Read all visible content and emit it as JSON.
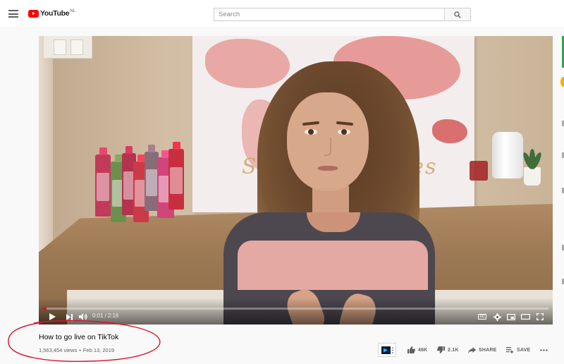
{
  "header": {
    "logo_text": "YouTube",
    "logo_region": "NL",
    "search_placeholder": "Search"
  },
  "player": {
    "current_time": "0:01",
    "separator": "/",
    "duration": "2:16",
    "progress_fraction": 0.0074,
    "cc_label": "CC",
    "map_script_left": "S",
    "map_script_right": "laces"
  },
  "video": {
    "title": "How to go live on TikTok",
    "views": "1,563,454 views",
    "dot": "•",
    "date": "Feb 13, 2019"
  },
  "actions": {
    "likes": "46K",
    "dislikes": "2.1K",
    "share": "SHARE",
    "save": "SAVE"
  },
  "icons": [
    "menu-icon",
    "youtube-logo-icon",
    "search-icon",
    "play-icon",
    "next-icon",
    "volume-icon",
    "cc-icon",
    "settings-icon",
    "miniplayer-icon",
    "theater-icon",
    "fullscreen-icon",
    "thumbs-up-icon",
    "thumbs-down-icon",
    "share-icon",
    "save-icon",
    "more-icon",
    "extension-icon"
  ],
  "colors": {
    "brand_red": "#ff0000",
    "annotation_red": "#d9152b",
    "text_primary": "#030303",
    "text_secondary": "#606060"
  }
}
